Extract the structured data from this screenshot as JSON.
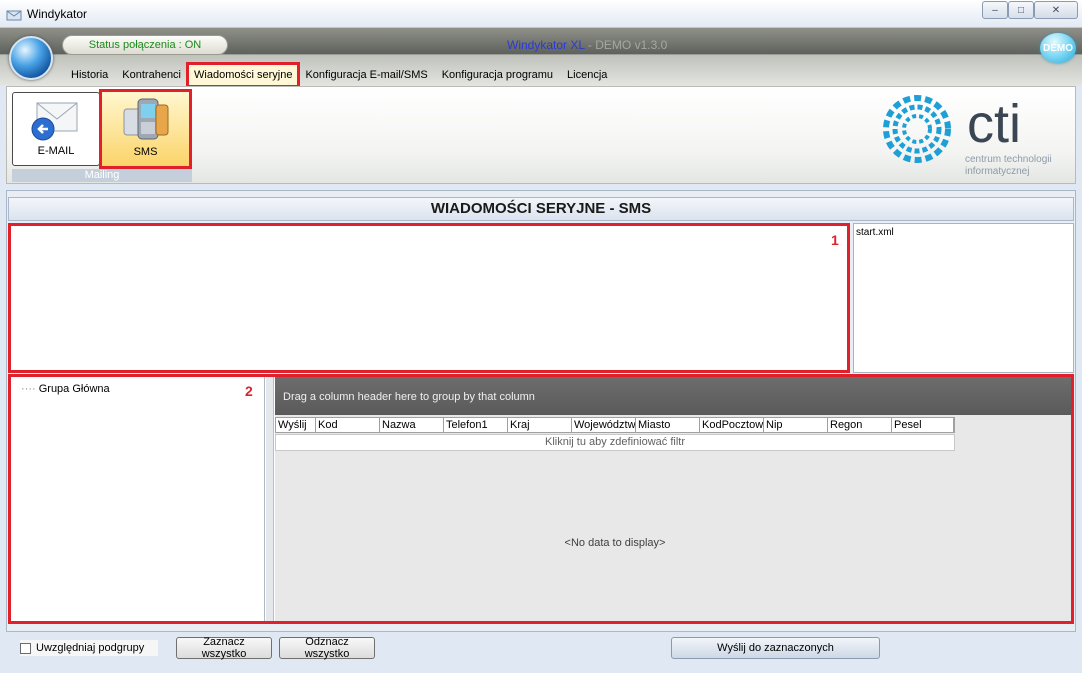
{
  "window": {
    "title": "Windykator",
    "buttons": [
      "–",
      "□",
      "✕"
    ]
  },
  "header": {
    "status": "Status połączenia : ON",
    "app_name": "Windykator XL",
    "version": " - DEMO v1.3.0",
    "badge": "DEMO"
  },
  "menu": {
    "items": [
      {
        "label": "Historia"
      },
      {
        "label": "Kontrahenci"
      },
      {
        "label": "Wiadomości seryjne",
        "active": true
      },
      {
        "label": "Konfiguracja E-mail/SMS"
      },
      {
        "label": "Konfiguracja programu"
      },
      {
        "label": "Licencja"
      }
    ]
  },
  "ribbon": {
    "email_label": "E-MAIL",
    "sms_label": "SMS",
    "group_label": "Mailing",
    "logo_text": "cti",
    "logo_sub1": "centrum technologii",
    "logo_sub2": "informatycznej"
  },
  "main": {
    "title": "WIADOMOŚCI SERYJNE - SMS",
    "marker1": "1",
    "marker2": "2",
    "file_name": "start.xml",
    "tree_root": "Grupa Główna",
    "group_hint": "Drag a column header here to group by that column",
    "columns": [
      "Wyślij",
      "Kod",
      "Nazwa",
      "Telefon1",
      "Kraj",
      "Województwo",
      "Miasto",
      "KodPocztowy",
      "Nip",
      "Regon",
      "Pesel"
    ],
    "filter_hint": "Kliknij tu aby zdefiniować filtr",
    "no_data": "<No data to display>"
  },
  "footer": {
    "include_subgroups": "Uwzględniaj podgrupy",
    "select_all": "Zaznacz wszystko",
    "deselect_all": "Odznacz wszystko",
    "send": "Wyślij do zaznaczonych"
  },
  "colors": {
    "highlight": "#e0202a",
    "logo": "#1e9fd6"
  }
}
